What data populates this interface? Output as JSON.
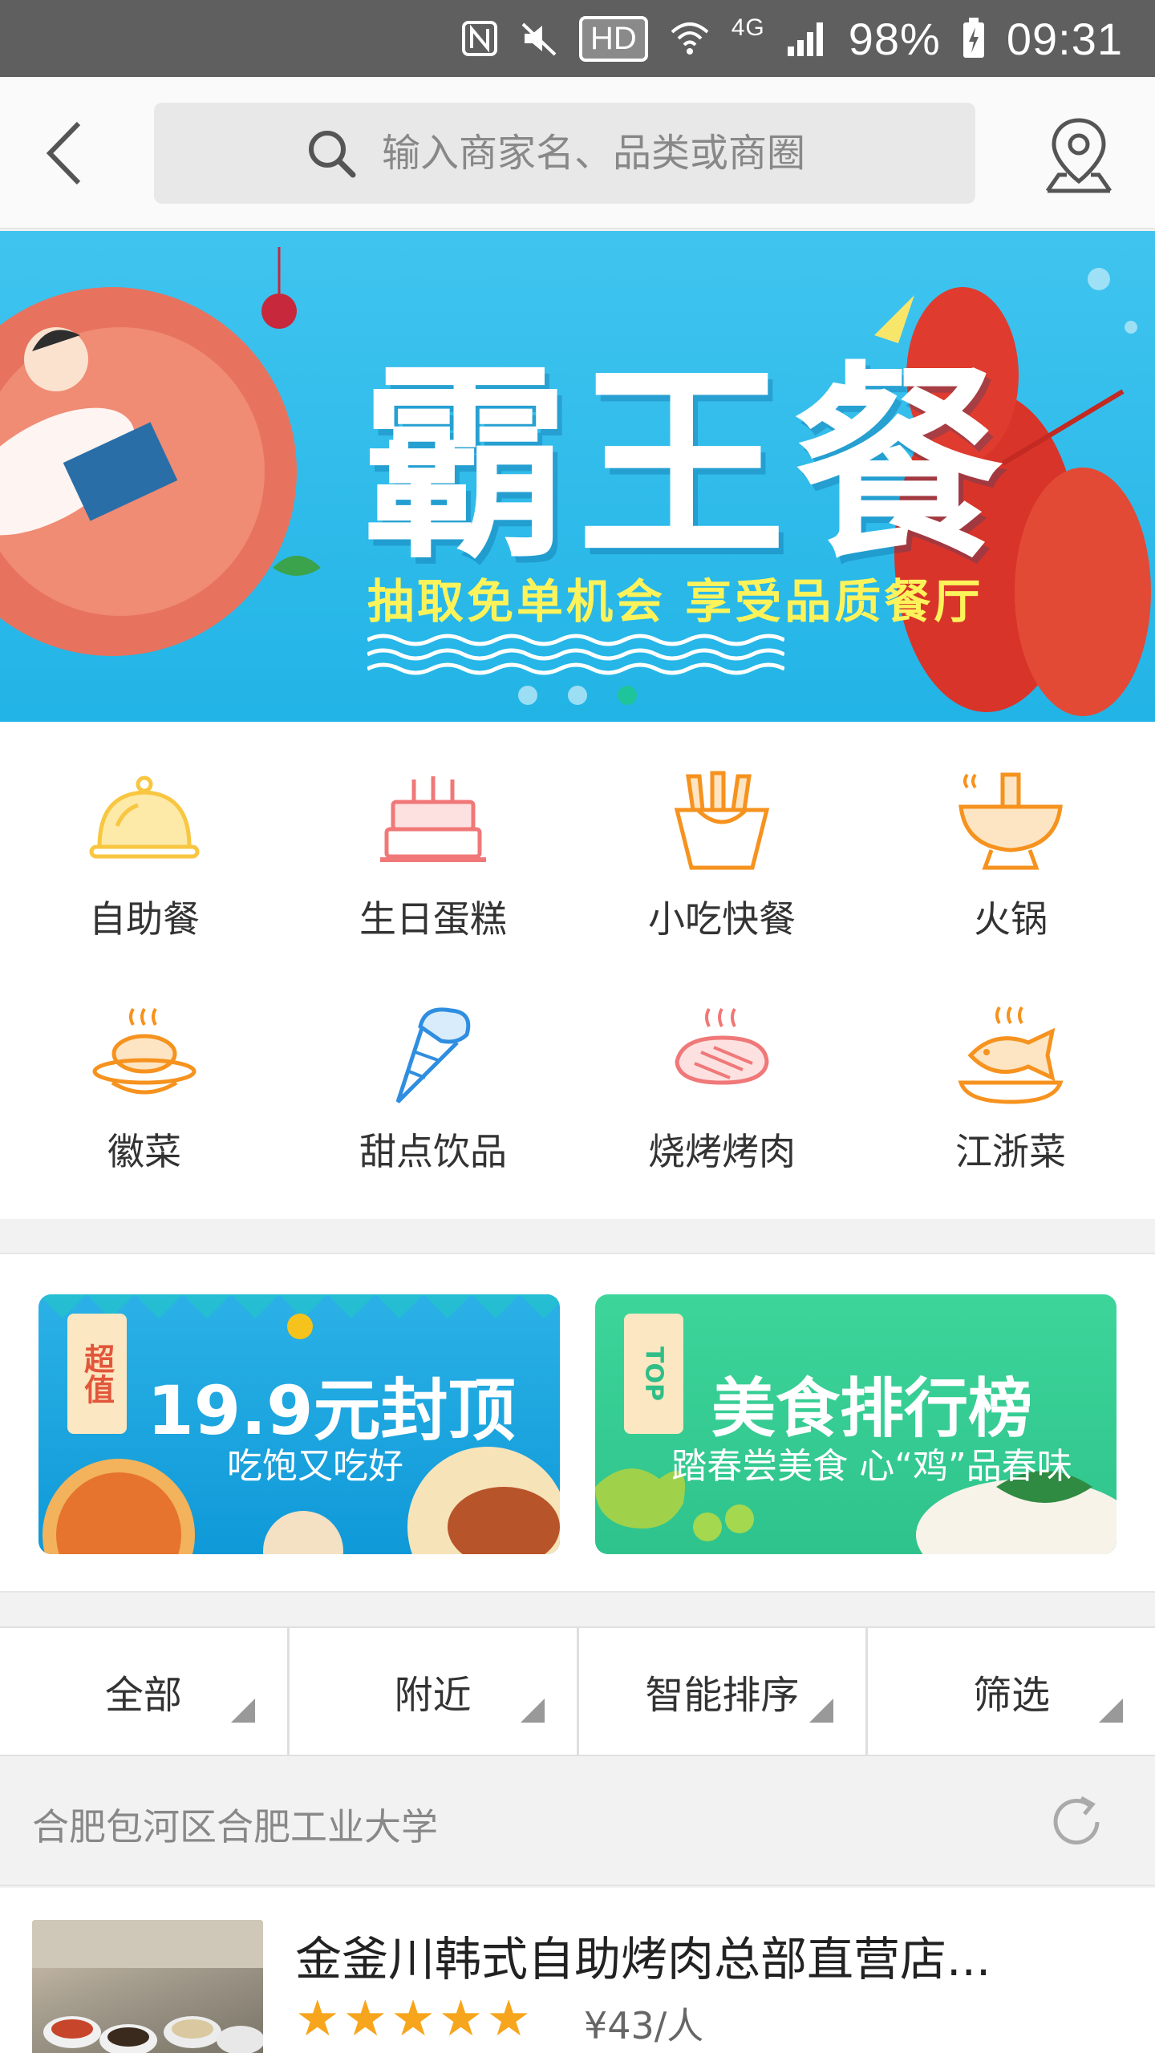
{
  "status_bar": {
    "battery": "98%",
    "time": "09:31",
    "hd": "HD",
    "network": "4G",
    "icons": [
      "nfc-icon",
      "mute-icon",
      "hd-icon",
      "wifi-icon",
      "signal-icon",
      "battery-icon"
    ]
  },
  "header": {
    "search_placeholder": "输入商家名、品类或商圈",
    "back_icon": "chevron-left-icon",
    "location_icon": "map-pin-icon"
  },
  "banner": {
    "title": "霸王餐",
    "subtitle": "抽取免单机会 享受品质餐厅",
    "slide_count": 3,
    "active_slide": 3
  },
  "categories": [
    {
      "label": "自助餐",
      "icon": "cloche-icon",
      "color": "#f8c640"
    },
    {
      "label": "生日蛋糕",
      "icon": "cake-icon",
      "color": "#f07878"
    },
    {
      "label": "小吃快餐",
      "icon": "fries-icon",
      "color": "#f6921e"
    },
    {
      "label": "火锅",
      "icon": "hotpot-icon",
      "color": "#f6921e"
    },
    {
      "label": "徽菜",
      "icon": "noodle-dish-icon",
      "color": "#f6921e"
    },
    {
      "label": "甜点饮品",
      "icon": "icecream-icon",
      "color": "#2f8ee0"
    },
    {
      "label": "烧烤烤肉",
      "icon": "steak-icon",
      "color": "#f07878"
    },
    {
      "label": "江浙菜",
      "icon": "fish-dish-icon",
      "color": "#f6921e"
    }
  ],
  "promos": [
    {
      "tag": "超值",
      "title": "19.9元封顶",
      "subtitle": "吃饱又吃好"
    },
    {
      "tag": "TOP",
      "title": "美食排行榜",
      "subtitle": "踏春尝美食 心“鸡”品春味"
    }
  ],
  "filters": [
    "全部",
    "附近",
    "智能排序",
    "筛选"
  ],
  "location": {
    "address": "合肥包河区合肥工业大学",
    "refresh_icon": "refresh-icon"
  },
  "shop": {
    "name": "金釜川韩式自助烤肉总部直营店...",
    "rating": 5,
    "price": "¥43/人"
  },
  "colors": {
    "accent_orange": "#f6921e",
    "star": "#f7a51c",
    "banner_blue": "#2fbcea",
    "promo_green": "#35cc93"
  }
}
